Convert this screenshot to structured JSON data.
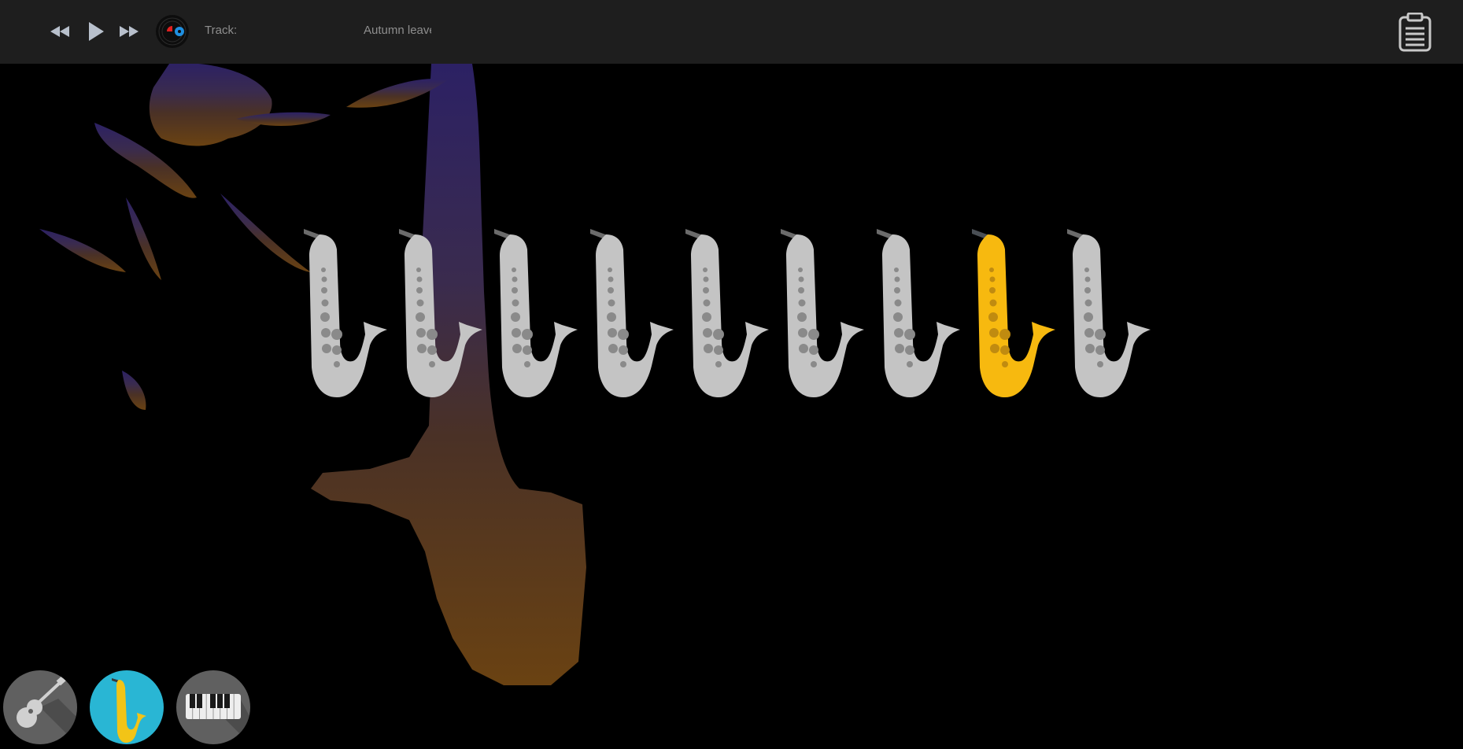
{
  "player": {
    "track_label": "Track:",
    "track_name": "Autumn leave",
    "controls": [
      "rewind-icon",
      "play-icon",
      "fast-forward-icon",
      "vinyl-record-icon"
    ]
  },
  "menu_icon": "clipboard-list-icon",
  "colors": {
    "topbar": "#1e1e1e",
    "sax_default": "#c4c4c4",
    "sax_active": "#f7b90f",
    "instrument_active": "#29b6d4",
    "instrument_inactive": "#606060"
  },
  "saxophones": {
    "count": 9,
    "active_index": 7
  },
  "instruments": [
    {
      "name": "guitar",
      "icon": "guitar-icon",
      "active": false
    },
    {
      "name": "saxophone",
      "icon": "saxophone-icon",
      "active": true
    },
    {
      "name": "piano",
      "icon": "piano-keys-icon",
      "active": false
    }
  ]
}
